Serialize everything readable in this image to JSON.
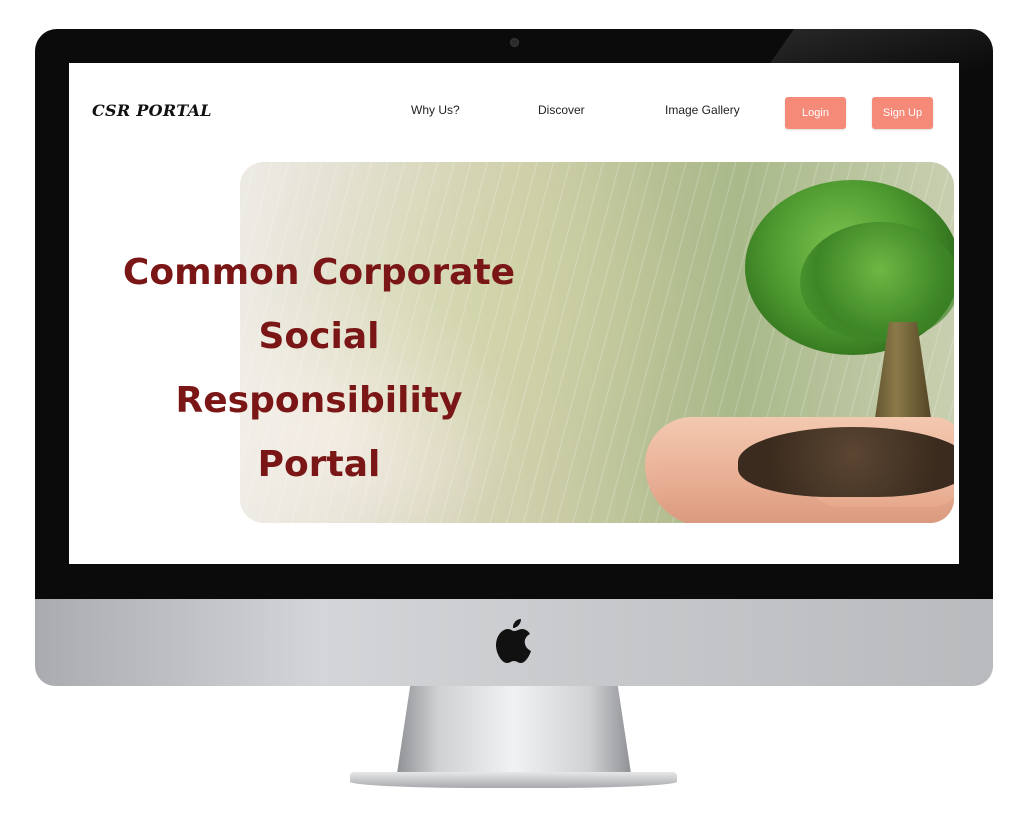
{
  "navbar": {
    "brand": "CSR PORTAL",
    "links": [
      "Why Us?",
      "Discover",
      "Image Gallery"
    ],
    "login_label": "Login",
    "signup_label": "Sign Up"
  },
  "hero": {
    "title_lines": [
      "Common Corporate",
      "Social Responsibility",
      "Portal"
    ]
  },
  "colors": {
    "accent": "#f58a78",
    "title": "#7a1616"
  },
  "icons": {
    "device_logo": "apple-logo-icon"
  }
}
